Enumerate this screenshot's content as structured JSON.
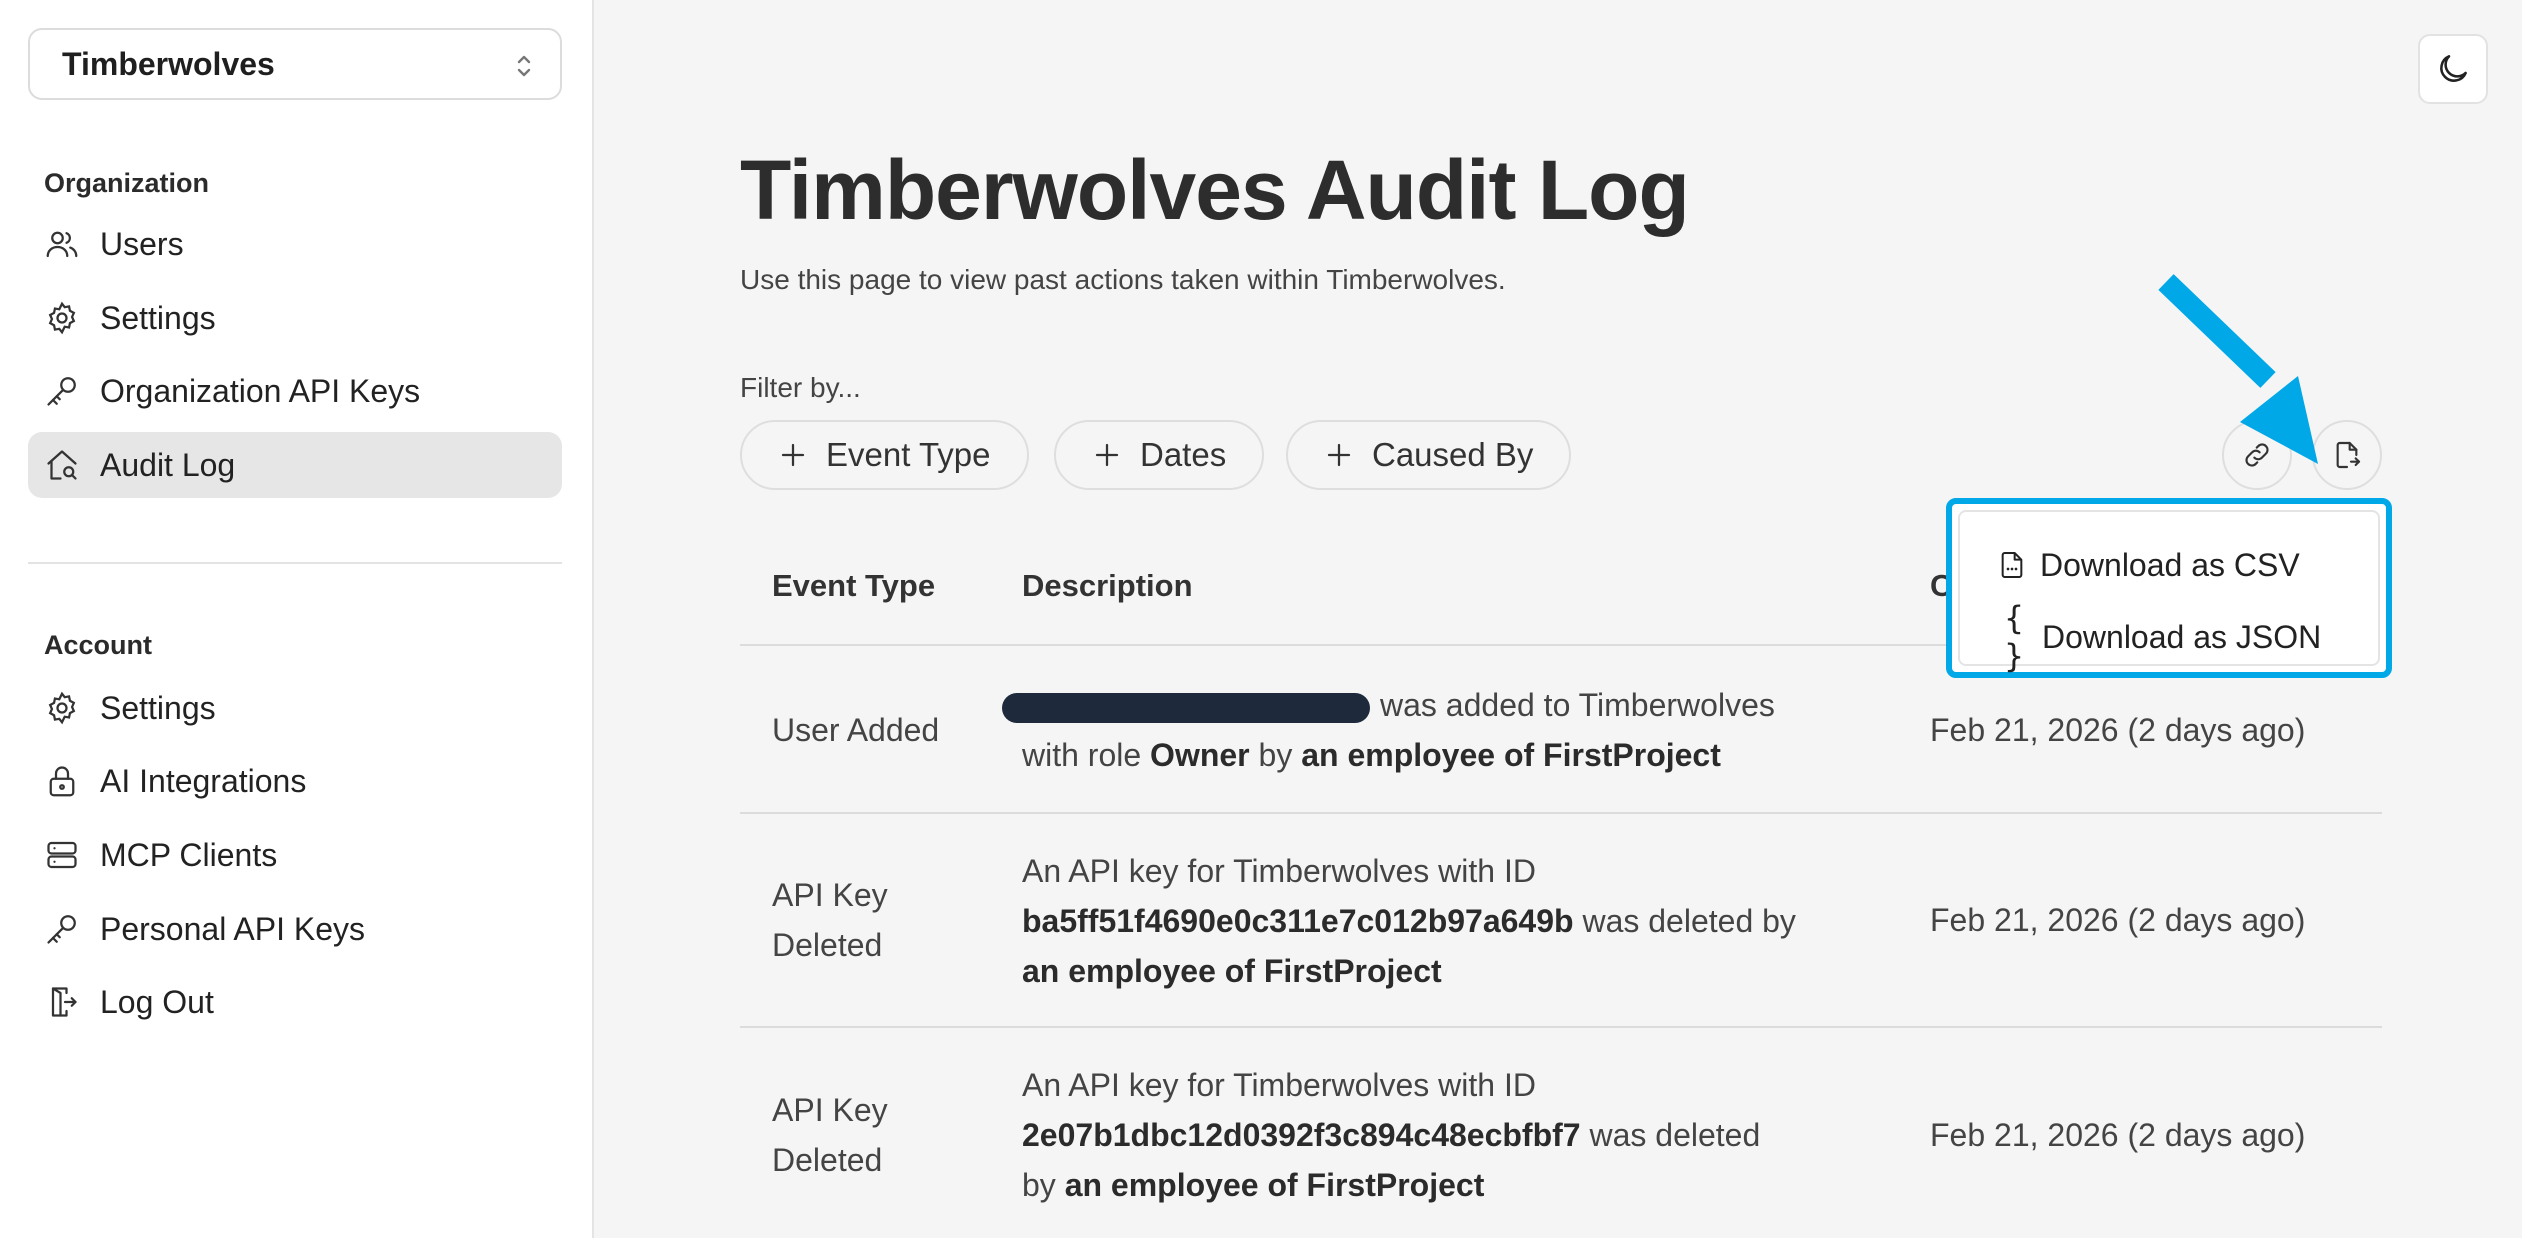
{
  "org_selector": {
    "value": "Timberwolves"
  },
  "sidebar": {
    "org_section": {
      "label": "Organization",
      "items": [
        {
          "label": "Users",
          "icon": "users-icon"
        },
        {
          "label": "Settings",
          "icon": "gear-icon"
        },
        {
          "label": "Organization API Keys",
          "icon": "key-icon"
        },
        {
          "label": "Audit Log",
          "icon": "audit-icon",
          "active": true
        }
      ]
    },
    "account_section": {
      "label": "Account",
      "items": [
        {
          "label": "Settings",
          "icon": "gear-icon"
        },
        {
          "label": "AI Integrations",
          "icon": "lock-icon"
        },
        {
          "label": "MCP Clients",
          "icon": "server-icon"
        },
        {
          "label": "Personal API Keys",
          "icon": "key-icon"
        },
        {
          "label": "Log Out",
          "icon": "logout-icon"
        }
      ]
    }
  },
  "main": {
    "title": "Timberwolves Audit Log",
    "subtitle": "Use this page to view past actions taken within Timberwolves.",
    "filter_label": "Filter by...",
    "filters": [
      "Event Type",
      "Dates",
      "Caused By"
    ],
    "table": {
      "headers": [
        "Event Type",
        "Description",
        "C"
      ],
      "rows": [
        {
          "event_type": "User Added",
          "desc_parts": [
            "was added to Timberwolves",
            "with role",
            "Owner",
            "by",
            "an employee of FirstProject"
          ],
          "date": "Feb 21, 2026 (2 days ago)"
        },
        {
          "event_type_1": "API Key",
          "event_type_2": "Deleted",
          "desc_parts": [
            "An API key for Timberwolves with ID",
            "ba5ff51f4690e0c311e7c012b97a649b",
            "was deleted by",
            "an employee of FirstProject"
          ],
          "date": "Feb 21, 2026 (2 days ago)"
        },
        {
          "event_type_1": "API Key",
          "event_type_2": "Deleted",
          "desc_parts": [
            "An API key for Timberwolves with ID",
            "2e07b1dbc12d0392f3c894c48ecbfbf7",
            "was deleted",
            "by",
            "an employee of FirstProject"
          ],
          "date": "Feb 21, 2026 (2 days ago)"
        }
      ]
    },
    "download_menu": {
      "items": [
        "Download as CSV",
        "Download as JSON"
      ],
      "json_glyph": "{ }"
    }
  },
  "colors": {
    "highlight": "#00a8e8",
    "redaction": "#1e2a3c"
  }
}
